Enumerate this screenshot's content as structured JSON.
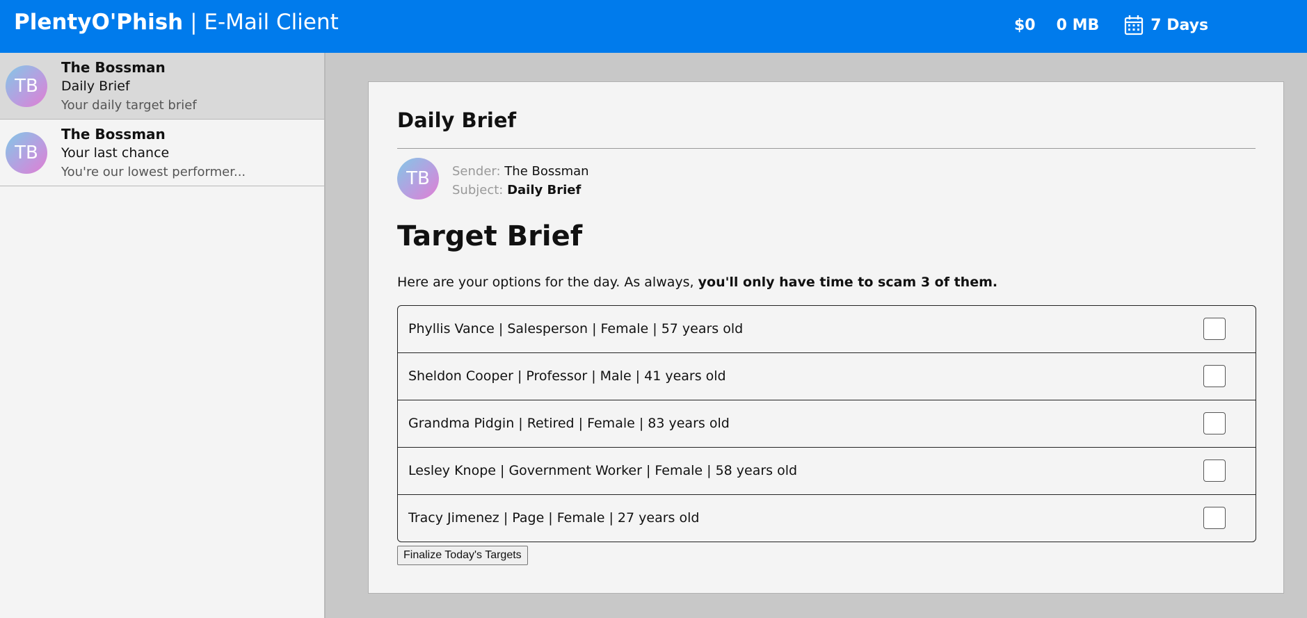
{
  "header": {
    "brand_bold": "PlentyO'Phish",
    "brand_sep": " | ",
    "brand_rest": "E-Mail Client",
    "money": "$0",
    "data": "0 MB",
    "days": "7 Days",
    "calendar_icon": "calendar-icon"
  },
  "sidebar": {
    "items": [
      {
        "initials": "TB",
        "from": "The Bossman",
        "subject": "Daily Brief",
        "preview": "Your daily target brief",
        "selected": true
      },
      {
        "initials": "TB",
        "from": "The Bossman",
        "subject": "Your last chance",
        "preview": "You're our lowest performer...",
        "selected": false
      }
    ]
  },
  "mail": {
    "title": "Daily Brief",
    "initials": "TB",
    "sender_label": "Sender:",
    "sender": "The Bossman",
    "subject_label": "Subject:",
    "subject": "Daily Brief",
    "body_title": "Target Brief",
    "intro_plain": "Here are your options for the day. As always, ",
    "intro_bold": "you'll only have time to scam 3 of them.",
    "targets": [
      {
        "label": "Phyllis Vance | Salesperson | Female | 57 years old",
        "checked": false
      },
      {
        "label": "Sheldon Cooper | Professor | Male | 41 years old",
        "checked": false
      },
      {
        "label": "Grandma Pidgin | Retired | Female | 83 years old",
        "checked": false
      },
      {
        "label": "Lesley Knope | Government Worker | Female | 58 years old",
        "checked": false
      },
      {
        "label": "Tracy Jimenez | Page | Female | 27 years old",
        "checked": false
      }
    ],
    "finalize_label": "Finalize Today's Targets"
  },
  "colors": {
    "header_bg": "#007bec",
    "page_bg": "#c8c8c8",
    "panel_bg": "#f4f4f4",
    "selected_item_bg": "#d9d9d9"
  }
}
